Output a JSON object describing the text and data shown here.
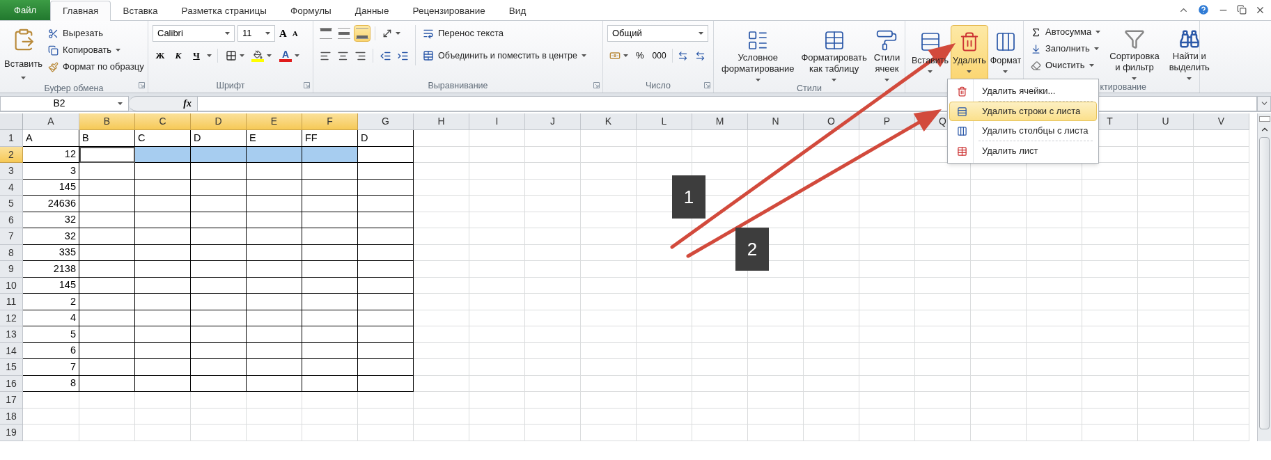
{
  "tabs": [
    {
      "label": "Файл",
      "kind": "file",
      "selected": false
    },
    {
      "label": "Главная",
      "kind": "tab",
      "selected": true
    },
    {
      "label": "Вставка",
      "kind": "tab",
      "selected": false
    },
    {
      "label": "Разметка страницы",
      "kind": "tab",
      "selected": false
    },
    {
      "label": "Формулы",
      "kind": "tab",
      "selected": false
    },
    {
      "label": "Данные",
      "kind": "tab",
      "selected": false
    },
    {
      "label": "Рецензирование",
      "kind": "tab",
      "selected": false
    },
    {
      "label": "Вид",
      "kind": "tab",
      "selected": false
    }
  ],
  "ribbon": {
    "clipboard": {
      "label": "Буфер обмена",
      "paste": "Вставить",
      "cut": "Вырезать",
      "copy": "Копировать",
      "format_painter": "Формат по образцу"
    },
    "font": {
      "label": "Шрифт",
      "name": "Calibri",
      "size": "11",
      "grow": "A",
      "shrink": "A",
      "bold": "Ж",
      "italic": "К",
      "underline": "Ч",
      "font_color": "A"
    },
    "alignment": {
      "label": "Выравнивание",
      "vertical": [
        {
          "selected": false
        },
        {
          "selected": false
        },
        {
          "selected": true
        }
      ],
      "wrap": "Перенос текста",
      "merge": "Объединить и поместить в центре"
    },
    "number": {
      "label": "Число",
      "format": "Общий",
      "percent": "%",
      "thousands": "000"
    },
    "styles": {
      "label": "Стили",
      "items": [
        "Условное\nформатирование",
        "Форматировать\nкак таблицу",
        "Стили\nячеек"
      ]
    },
    "cells": {
      "items": [
        {
          "label": "Вставить",
          "selected": false
        },
        {
          "label": "Удалить",
          "selected": true
        },
        {
          "label": "Формат",
          "selected": false
        }
      ]
    },
    "editing": {
      "label": "ктирование",
      "small": [
        "Автосумма",
        "Заполнить",
        "Очистить"
      ],
      "big": [
        "Сортировка\nи фильтр",
        "Найти и\nвыделить"
      ]
    }
  },
  "formula_bar": {
    "name_box": "B2",
    "fx": "fx"
  },
  "columns": [
    {
      "letter": "A",
      "selected": false,
      "active": false,
      "bordered": true
    },
    {
      "letter": "B",
      "selected": true,
      "active": true,
      "bordered": true
    },
    {
      "letter": "C",
      "selected": true,
      "active": false,
      "bordered": true
    },
    {
      "letter": "D",
      "selected": true,
      "active": false,
      "bordered": true
    },
    {
      "letter": "E",
      "selected": true,
      "active": false,
      "bordered": true
    },
    {
      "letter": "F",
      "selected": true,
      "active": false,
      "bordered": true
    },
    {
      "letter": "G",
      "selected": false,
      "active": false,
      "bordered": true
    },
    {
      "letter": "H",
      "selected": false,
      "active": false,
      "bordered": false
    },
    {
      "letter": "I",
      "selected": false,
      "active": false,
      "bordered": false
    },
    {
      "letter": "J",
      "selected": false,
      "active": false,
      "bordered": false
    },
    {
      "letter": "K",
      "selected": false,
      "active": false,
      "bordered": false
    },
    {
      "letter": "L",
      "selected": false,
      "active": false,
      "bordered": false
    },
    {
      "letter": "M",
      "selected": false,
      "active": false,
      "bordered": false
    },
    {
      "letter": "N",
      "selected": false,
      "active": false,
      "bordered": false
    },
    {
      "letter": "O",
      "selected": false,
      "active": false,
      "bordered": false
    },
    {
      "letter": "P",
      "selected": false,
      "active": false,
      "bordered": false
    },
    {
      "letter": "Q",
      "selected": false,
      "active": false,
      "bordered": false
    },
    {
      "bordered": false
    },
    {
      "bordered": false
    },
    {
      "letter": "T",
      "selected": false,
      "active": false,
      "bordered": false
    },
    {
      "letter": "U",
      "selected": false,
      "active": false,
      "bordered": false
    },
    {
      "letter": "V",
      "selected": false,
      "active": false,
      "bordered": false
    }
  ],
  "rows": [
    {
      "number": "1",
      "selected": false,
      "bordered": true,
      "cells": [
        "A",
        "B",
        "C",
        "D",
        "E",
        "FF",
        "D"
      ]
    },
    {
      "number": "2",
      "selected": true,
      "bordered": true,
      "value": "12"
    },
    {
      "number": "3",
      "selected": false,
      "bordered": true,
      "value": "3"
    },
    {
      "number": "4",
      "selected": false,
      "bordered": true,
      "value": "145"
    },
    {
      "number": "5",
      "selected": false,
      "bordered": true,
      "value": "24636"
    },
    {
      "number": "6",
      "selected": false,
      "bordered": true,
      "value": "32"
    },
    {
      "number": "7",
      "selected": false,
      "bordered": true,
      "value": "32"
    },
    {
      "number": "8",
      "selected": false,
      "bordered": true,
      "value": "335"
    },
    {
      "number": "9",
      "selected": false,
      "bordered": true,
      "value": "2138"
    },
    {
      "number": "10",
      "selected": false,
      "bordered": true,
      "value": "145"
    },
    {
      "number": "11",
      "selected": false,
      "bordered": true,
      "value": "2"
    },
    {
      "number": "12",
      "selected": false,
      "bordered": true,
      "value": "4"
    },
    {
      "number": "13",
      "selected": false,
      "bordered": true,
      "value": "5"
    },
    {
      "number": "14",
      "selected": false,
      "bordered": true,
      "value": "6"
    },
    {
      "number": "15",
      "selected": false,
      "bordered": true,
      "value": "7"
    },
    {
      "number": "16",
      "selected": false,
      "bordered": true,
      "value": "8"
    },
    {
      "number": "17",
      "selected": false,
      "bordered": false
    },
    {
      "number": "18",
      "selected": false,
      "bordered": false
    },
    {
      "number": "19",
      "selected": false,
      "bordered": false
    }
  ],
  "delete_menu": [
    {
      "label": "Удалить ячейки...",
      "selected": false
    },
    {
      "label": "Удалить строки с листа",
      "selected": true
    },
    {
      "label": "Удалить столбцы с листа",
      "selected": false
    },
    {
      "label": "Удалить лист",
      "selected": false
    }
  ],
  "annotations": [
    {
      "label": "1"
    },
    {
      "label": "2"
    }
  ]
}
